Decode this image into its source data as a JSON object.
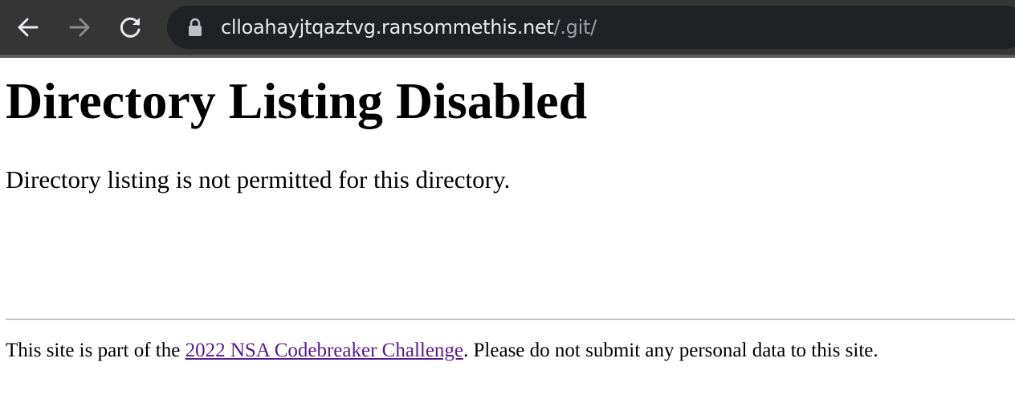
{
  "browser": {
    "url_host": "clloahayjtqaztvg.ransommethis.net",
    "url_path": "/.git/",
    "icons": {
      "back": "arrow-left-icon",
      "forward": "arrow-right-icon",
      "reload": "reload-icon",
      "security": "lock-icon"
    },
    "colors": {
      "toolbar": "#353535",
      "omnibox": "#202124",
      "url_text": "#e8eaed",
      "url_path": "#9aa0a6"
    }
  },
  "page": {
    "title": "Directory Listing Disabled",
    "message": "Directory listing is not permitted for this directory.",
    "footer": {
      "prefix": "This site is part of the ",
      "link_text": "2022 NSA Codebreaker Challenge",
      "suffix": ". Please do not submit any personal data to this site."
    },
    "colors": {
      "link_visited": "#551a8b"
    }
  }
}
